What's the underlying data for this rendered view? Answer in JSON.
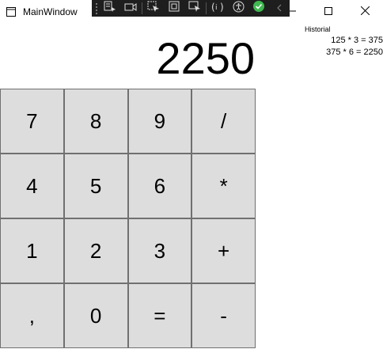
{
  "window": {
    "title": "MainWindow",
    "controls": {
      "minimize": "minimize",
      "maximize": "maximize",
      "close": "close"
    }
  },
  "devtools": {
    "icons": [
      "go-to-live-visual-tree-icon",
      "select-element-icon",
      "display-layout-adorners-icon",
      "track-focused-element-icon",
      "binding-failures-icon",
      "accessibility-scanner-icon",
      "hot-reload-status-icon",
      "collapse-icon"
    ],
    "status_color": "#3fb950"
  },
  "display": {
    "value": "2250"
  },
  "history": {
    "label": "Historial",
    "entries": [
      "125 * 3 = 375",
      "375 * 6 = 2250"
    ]
  },
  "keypad": {
    "keys": [
      "7",
      "8",
      "9",
      "/",
      "4",
      "5",
      "6",
      "*",
      "1",
      "2",
      "3",
      "+",
      ",",
      "0",
      "=",
      "-"
    ]
  },
  "colors": {
    "key_bg": "#dddddd",
    "key_border": "#707070",
    "toolbar_bg": "#1e1e1e"
  }
}
